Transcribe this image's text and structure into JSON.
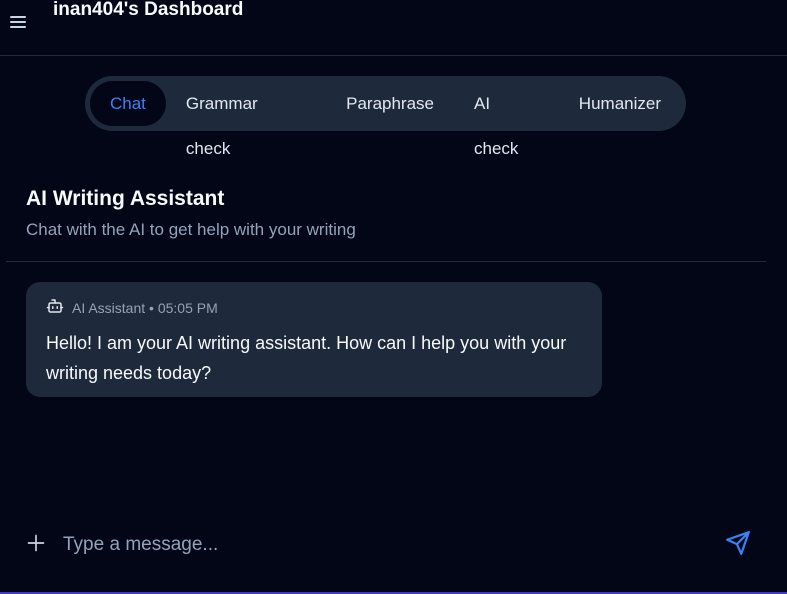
{
  "header": {
    "title": "inan404's Dashboard"
  },
  "tabs": [
    {
      "label": "Chat",
      "active": true
    },
    {
      "label": "Grammar check"
    },
    {
      "label": "Paraphrase"
    },
    {
      "label": "AI check"
    },
    {
      "label": "Humanizer"
    }
  ],
  "section": {
    "title": "AI Writing Assistant",
    "subtitle": "Chat with the AI to get help with your writing"
  },
  "messages": [
    {
      "meta": "AI Assistant • 05:05 PM",
      "icon": "bot-icon",
      "text": "Hello! I am your AI writing assistant. How can I help you with your writing needs today?"
    }
  ],
  "composer": {
    "placeholder": "Type a message...",
    "value": ""
  },
  "colors": {
    "background": "#020617",
    "surface": "#1e293b",
    "accent": "#3b82f6"
  }
}
